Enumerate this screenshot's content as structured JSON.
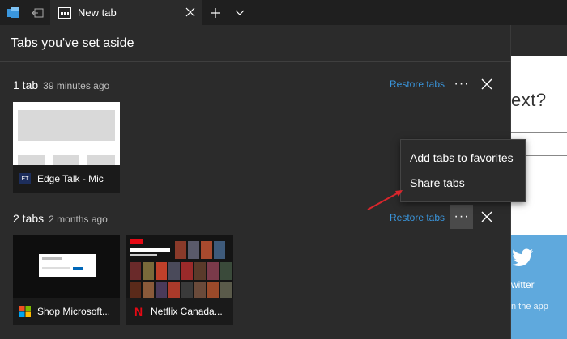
{
  "browser": {
    "active_tab": {
      "label": "New tab"
    }
  },
  "background_page": {
    "partial_heading": "ext?",
    "twitter_label": "witter",
    "twitter_sub": "n the app"
  },
  "panel": {
    "title": "Tabs you've set aside",
    "groups": [
      {
        "count_label": "1 tab",
        "time": "39 minutes ago",
        "restore_label": "Restore tabs",
        "more_label": "···",
        "tabs": [
          {
            "label": "Edge Talk - Mic",
            "favicon": "ET"
          }
        ]
      },
      {
        "count_label": "2 tabs",
        "time": "2 months ago",
        "restore_label": "Restore tabs",
        "more_label": "···",
        "tabs": [
          {
            "label": "Shop Microsoft..."
          },
          {
            "label": "Netflix Canada...",
            "favicon": "N"
          }
        ]
      }
    ]
  },
  "context_menu": {
    "items": [
      "Add tabs to favorites",
      "Share tabs"
    ]
  },
  "colors": {
    "accent_link": "#3a96dd",
    "arrow": "#d9262c",
    "netflix_red": "#e50914"
  }
}
